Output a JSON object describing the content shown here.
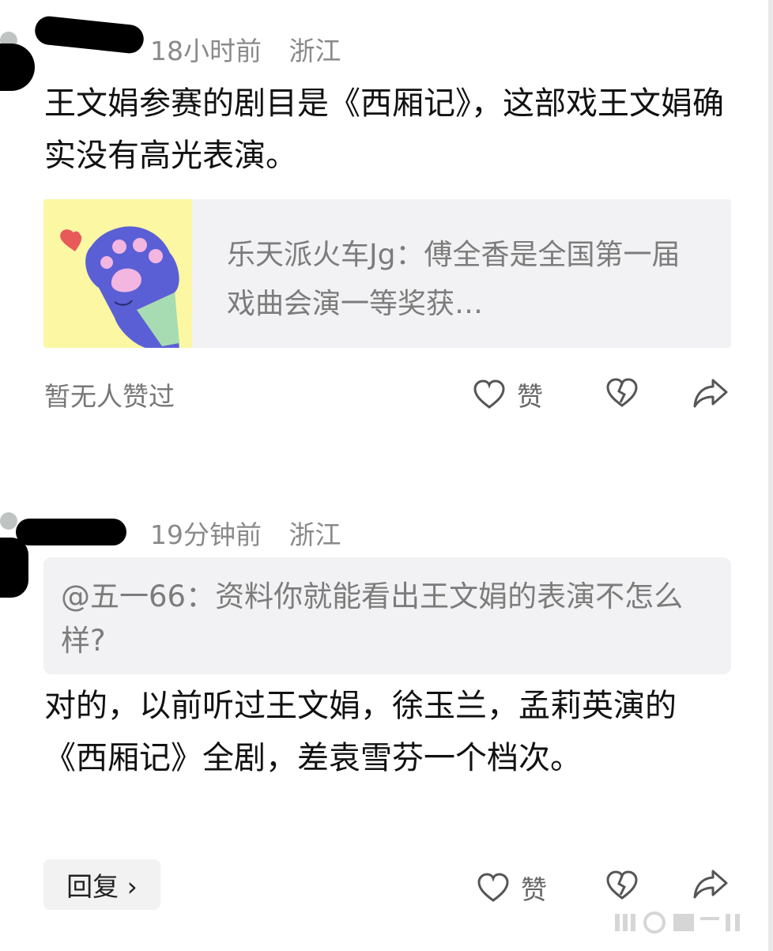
{
  "comments": [
    {
      "time": "18小时前",
      "location": "浙江",
      "body": "王文娟参赛的剧目是《西厢记》，这部戏王文娟确实没有高光表演。",
      "quote": {
        "text": "乐天派火车Jg：傅全香是全国第一届戏曲会演一等奖获…"
      },
      "likes_status": "暂无人赞过",
      "like_label": "赞"
    },
    {
      "time": "19分钟前",
      "location": "浙江",
      "reply_to": "@五一66：资料你就能看出王文娟的表演不怎么样?",
      "body": "对的，以前听过王文娟，徐玉兰，孟莉英演的《西厢记》全剧，差袁雪芬一个档次。",
      "reply_button": "回复 ›",
      "like_label": "赞"
    }
  ],
  "icons": {
    "like": "heart-outline-icon",
    "dislike": "broken-heart-icon",
    "share": "share-arrow-icon"
  },
  "colors": {
    "meta_text": "#8a8a8a",
    "card_bg": "#f2f2f4",
    "thumb_bg": "#fbf7a2",
    "paw": "#5b5fd6"
  }
}
